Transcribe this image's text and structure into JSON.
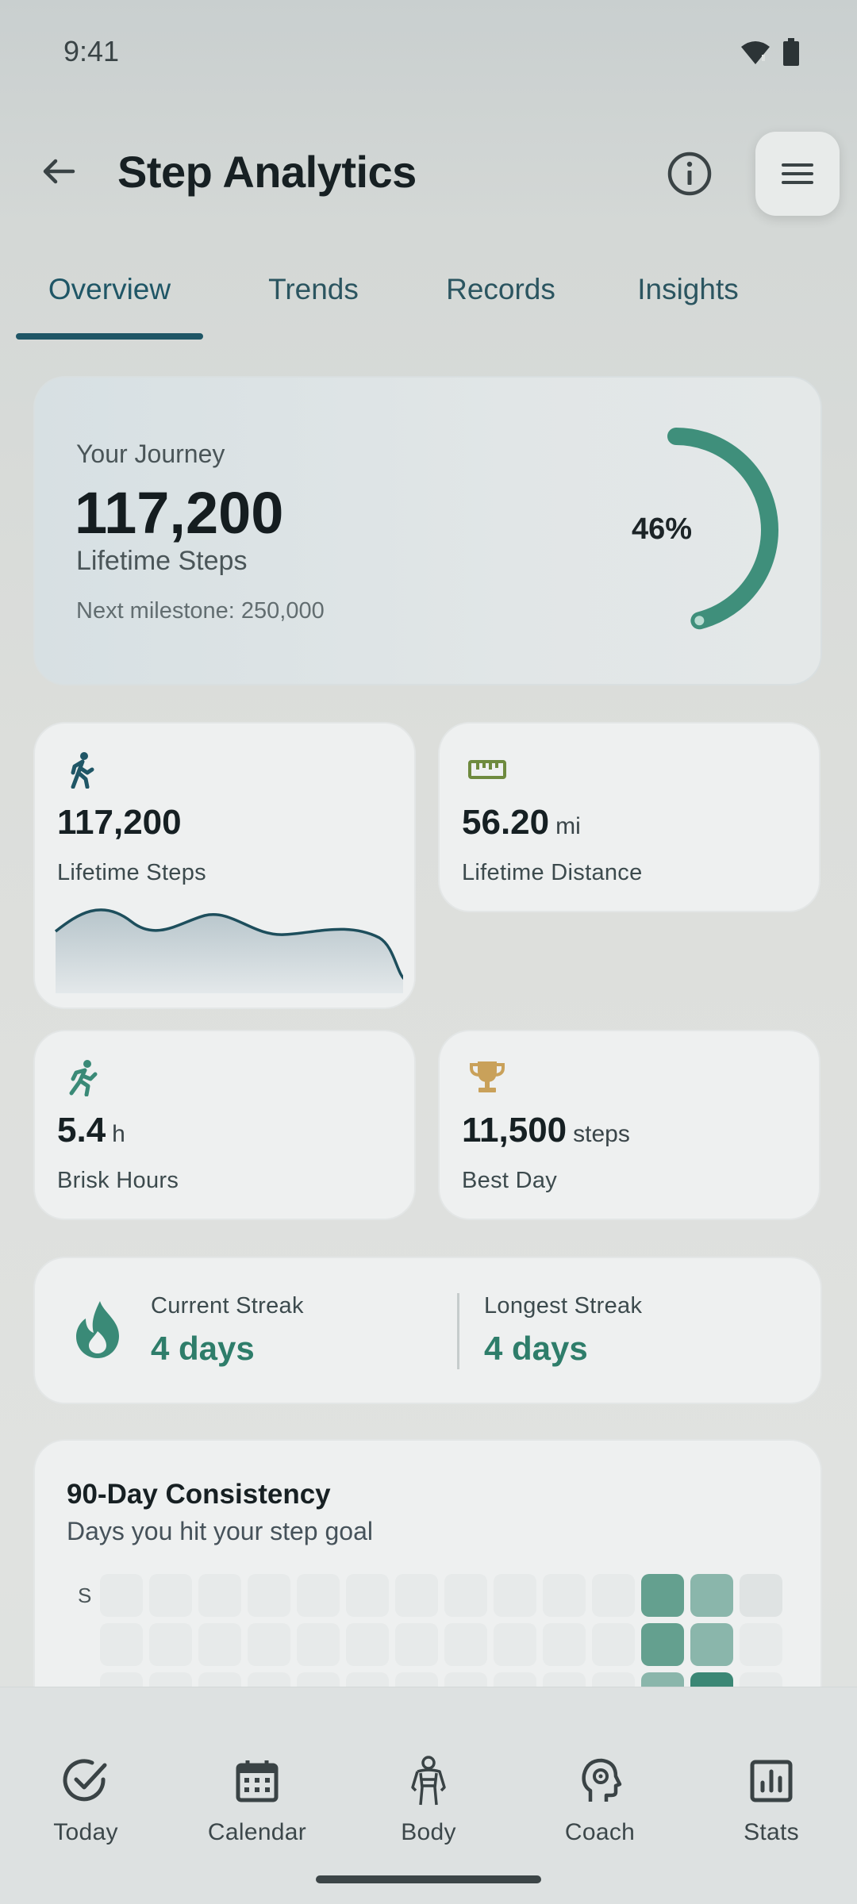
{
  "status_bar": {
    "time": "9:41",
    "icons": [
      "wifi-icon",
      "battery-icon"
    ]
  },
  "app_bar": {
    "title": "Step Analytics",
    "icons": [
      "back-arrow-icon",
      "info-icon",
      "menu-icon"
    ]
  },
  "tabs": [
    {
      "label": "Overview",
      "active": true
    },
    {
      "label": "Trends",
      "active": false
    },
    {
      "label": "Records",
      "active": false
    },
    {
      "label": "Insights",
      "active": false
    }
  ],
  "journey": {
    "label": "Your Journey",
    "value": "117,200",
    "sub": "Lifetime Steps",
    "next_milestone": "Next milestone: 250,000",
    "progress_text": "46%",
    "progress_fraction": 0.46
  },
  "stats": {
    "lifetime_steps": {
      "value": "117,200",
      "unit": "",
      "label": "Lifetime Steps",
      "icon": "walking-icon"
    },
    "lifetime_distance": {
      "value": "56.20",
      "unit": "mi",
      "label": "Lifetime Distance",
      "icon": "ruler-icon"
    },
    "brisk_hours": {
      "value": "5.4",
      "unit": "h",
      "label": "Brisk Hours",
      "icon": "running-icon"
    },
    "best_day": {
      "value": "11,500",
      "unit": "steps",
      "label": "Best Day",
      "icon": "trophy-icon"
    }
  },
  "streaks": {
    "current_label": "Current Streak",
    "current_value": "4 days",
    "longest_label": "Longest Streak",
    "longest_value": "4 days",
    "icon": "flame-icon"
  },
  "consistency": {
    "title": "90-Day Consistency",
    "subtitle": "Days you hit your step goal",
    "row_label": "S"
  },
  "bottom_nav": [
    {
      "label": "Today",
      "icon": "check-circle-icon"
    },
    {
      "label": "Calendar",
      "icon": "calendar-icon"
    },
    {
      "label": "Body",
      "icon": "body-icon"
    },
    {
      "label": "Coach",
      "icon": "coach-head-icon"
    },
    {
      "label": "Stats",
      "icon": "bar-chart-icon"
    }
  ],
  "colors": {
    "accent": "#2e7d6a",
    "tab_accent": "#1f5666",
    "distance_icon": "#6e8a3e",
    "trophy_icon": "#c9a15a"
  }
}
